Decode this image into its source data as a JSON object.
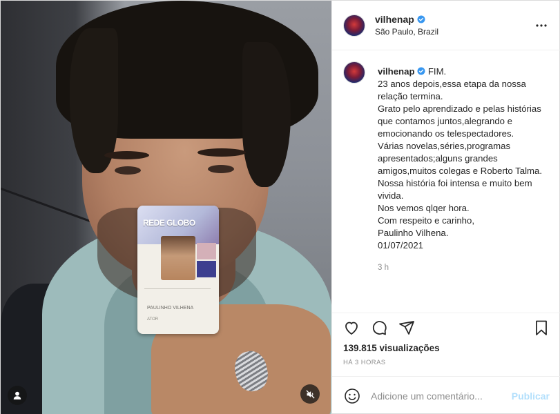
{
  "post": {
    "author": {
      "username": "vilhenap",
      "verified": true,
      "location": "São Paulo, Brazil"
    },
    "media": {
      "type": "video",
      "card_logo_text": "REDE GLOBO",
      "card_name": "PAULINHO VILHENA",
      "card_role": "ATOR"
    },
    "caption": {
      "username": "vilhenap",
      "lines": [
        "FIM.",
        "23 anos depois,essa etapa da nossa relação termina.",
        "Grato pelo aprendizado e pelas histórias que contamos juntos,alegrando e emocionando os telespectadores.",
        "Várias novelas,séries,programas apresentados;alguns grandes amigos,muitos colegas e Roberto Talma.",
        "Nossa história foi intensa e muito bem vivida.",
        "Nos vemos qlqer hora.",
        "Com respeito e carinho,",
        "Paulinho Vilhena.",
        "01/07/2021"
      ],
      "time_ago": "3 h"
    },
    "views": "139.815 visualizações",
    "date": "HÁ 3 HORAS",
    "comment": {
      "placeholder": "Adicione um comentário...",
      "post_label": "Publicar"
    },
    "icons": {
      "like": "heart-icon",
      "comment": "comment-icon",
      "share": "share-icon",
      "save": "bookmark-icon",
      "more": "more-icon",
      "emoji": "emoji-icon",
      "mute": "muted-speaker-icon",
      "user_tag": "user-tag-icon"
    },
    "colors": {
      "verified": "#3897f0",
      "post_button_disabled": "#b2dffc",
      "muted_text": "#8e8e8e"
    }
  }
}
